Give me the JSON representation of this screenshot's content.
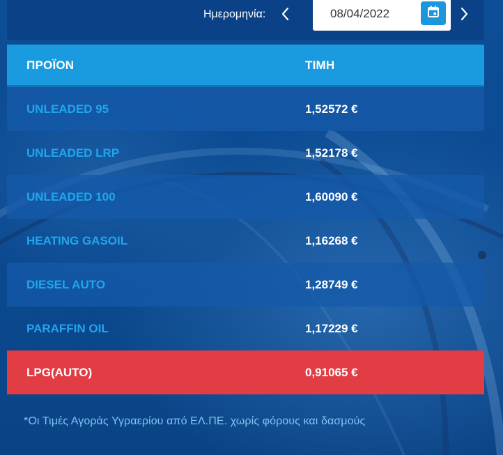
{
  "date_picker": {
    "label": "Ημερομηνία:",
    "value": "08/04/2022"
  },
  "table": {
    "headers": {
      "product": "ΠΡΟΪΟΝ",
      "price": "ΤΙΜΗ"
    },
    "rows": [
      {
        "product": "UNLEADED 95",
        "price": "1,52572 €"
      },
      {
        "product": "UNLEADED LRP",
        "price": "1,52178 €"
      },
      {
        "product": "UNLEADED 100",
        "price": "1,60090 €"
      },
      {
        "product": "HEATING GASOIL",
        "price": "1,16268 €"
      },
      {
        "product": "DIESEL AUTO",
        "price": "1,28749 €"
      },
      {
        "product": "PARAFFIN OIL",
        "price": "1,17229 €"
      },
      {
        "product": "LPG(AUTO)",
        "price": "0,91065 €"
      }
    ]
  },
  "footnote": "*Οι Τιμές Αγοράς Υγραερίου από ΕΛ.ΠΕ. χωρίς φόρους και δασμούς",
  "icons": {
    "prev": "chevron-left-icon",
    "next": "chevron-right-icon",
    "calendar": "calendar-icon"
  },
  "colors": {
    "header": "#1a9be0",
    "highlight": "#e23d44",
    "product_text": "#21a6ec",
    "background": "#0b4a93"
  }
}
